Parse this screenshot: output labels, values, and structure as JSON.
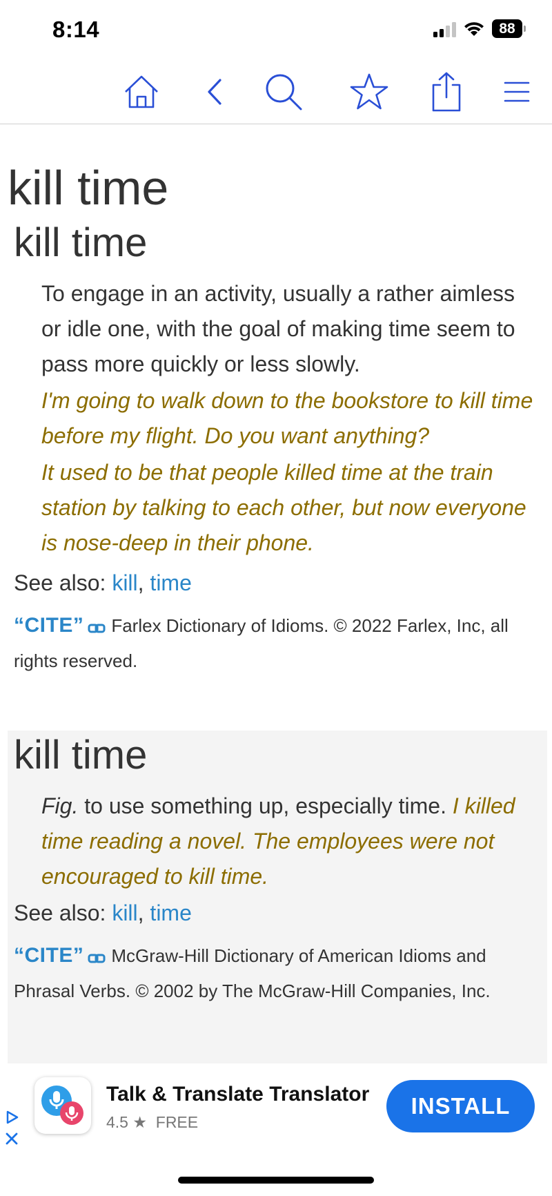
{
  "status_bar": {
    "time": "8:14",
    "battery": "88",
    "icons": [
      "signal-icon",
      "wifi-icon",
      "battery-icon"
    ]
  },
  "toolbar": {
    "icons": [
      "home-icon",
      "back-icon",
      "search-icon",
      "star-icon",
      "share-icon",
      "menu-icon"
    ],
    "accent_color": "#2a4fd6"
  },
  "page": {
    "title": "kill time"
  },
  "entries": [
    {
      "headword": "kill time",
      "definition": "To engage in an activity, usually a rather aimless or idle one, with the goal of making time seem to pass more quickly or less slowly.",
      "examples": [
        "I'm going to walk down to the bookstore to kill time before my flight. Do you want anything?",
        "It used to be that people killed time at the train station by talking to each other, but now everyone is nose-deep in their phone."
      ],
      "see_also_label": "See also:",
      "see_also_links": [
        "kill",
        "time"
      ],
      "cite_label": "“CITE”",
      "source": "Farlex Dictionary of Idioms. © 2022 Farlex, Inc, all rights reserved."
    },
    {
      "headword": "kill time",
      "label": "Fig.",
      "definition": "to use something up, especially time.",
      "examples": [
        "I killed time reading a novel. The employees were not encouraged to kill time."
      ],
      "see_also_label": "See also:",
      "see_also_links": [
        "kill",
        "time"
      ],
      "cite_label": "“CITE”",
      "source": "McGraw-Hill Dictionary of American Idioms and Phrasal Verbs. © 2002 by The McGraw-Hill Companies, Inc."
    }
  ],
  "ad": {
    "title": "Talk & Translate Translator",
    "rating": "4.5 ★",
    "price": "FREE",
    "cta": "INSTALL",
    "cta_color": "#1a73e8"
  },
  "colors": {
    "link": "#2a86c8",
    "example": "#8c6d00",
    "text": "#333333"
  }
}
